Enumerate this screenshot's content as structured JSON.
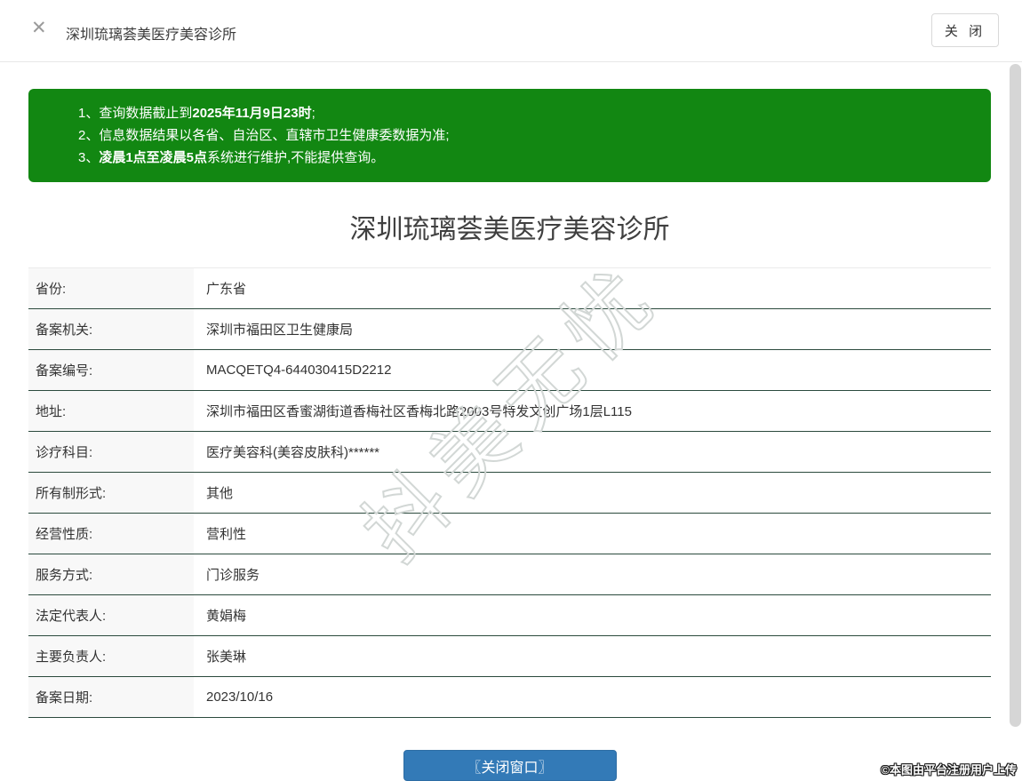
{
  "header": {
    "title": "深圳琉璃荟美医疗美容诊所",
    "close_icon": "✕",
    "close_button_label": "关 闭"
  },
  "notice": {
    "bg_color": "#128712",
    "items": [
      {
        "prefix": "1、",
        "pre": "查询数据截止到",
        "bold": "2025年11月9日23时",
        "post": ";"
      },
      {
        "prefix": "2、",
        "pre": "信息数据结果以各省、自治区、直辖市卫生健康委数据为准;",
        "bold": "",
        "post": ""
      },
      {
        "prefix": "3、",
        "pre": "",
        "bold": "凌晨1点至凌晨5点",
        "post": "系统进行维护,不能提供查询。"
      }
    ]
  },
  "detail": {
    "title": "深圳琉璃荟美医疗美容诊所",
    "rows": [
      {
        "label": "省份:",
        "value": "广东省"
      },
      {
        "label": "备案机关:",
        "value": "深圳市福田区卫生健康局"
      },
      {
        "label": "备案编号:",
        "value": "MACQETQ4-644030415D2212"
      },
      {
        "label": "地址:",
        "value": "深圳市福田区香蜜湖街道香梅社区香梅北路2003号特发文创广场1层L115"
      },
      {
        "label": "诊疗科目:",
        "value": "医疗美容科(美容皮肤科)******"
      },
      {
        "label": "所有制形式:",
        "value": "其他"
      },
      {
        "label": "经营性质:",
        "value": "营利性"
      },
      {
        "label": "服务方式:",
        "value": "门诊服务"
      },
      {
        "label": "法定代表人:",
        "value": "黄娟梅"
      },
      {
        "label": "主要负责人:",
        "value": "张美琳"
      },
      {
        "label": "备案日期:",
        "value": "2023/10/16"
      }
    ]
  },
  "watermark": "抖美无忧",
  "footer": {
    "close_button_label": "〖关闭窗口〗",
    "copyright": "©本图由平台注册用户上传"
  }
}
